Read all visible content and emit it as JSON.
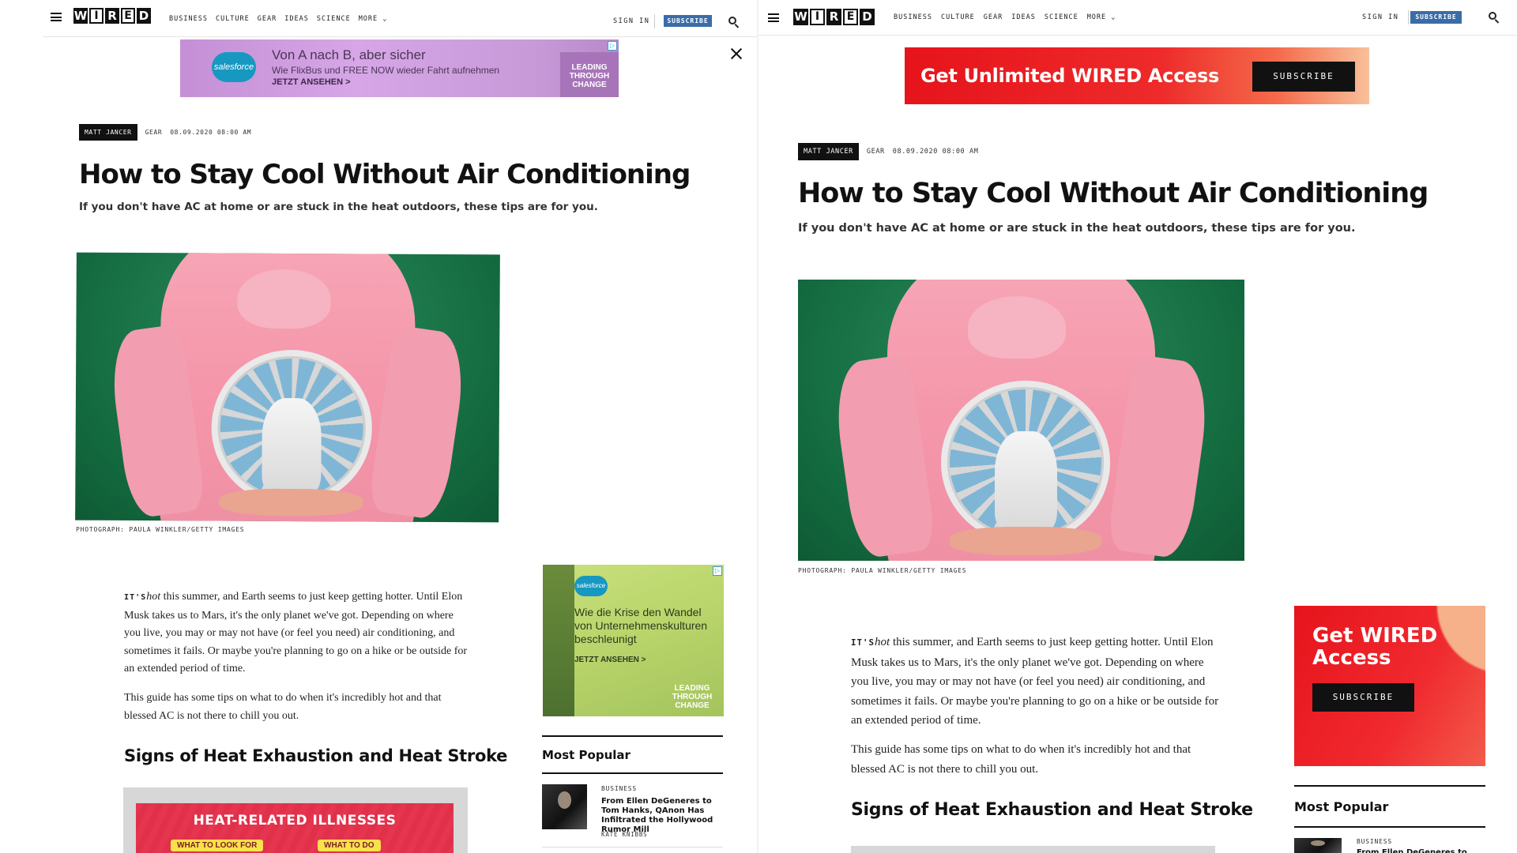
{
  "nav": {
    "logo_letters": [
      "W",
      "I",
      "R",
      "E",
      "D"
    ],
    "links": [
      "BUSINESS",
      "CULTURE",
      "GEAR",
      "IDEAS",
      "SCIENCE",
      "MORE"
    ],
    "sign_in": "SIGN IN",
    "subscribe": "SUBSCRIBE"
  },
  "ad_top": {
    "brand": "salesforce",
    "line1": "Von A nach B, aber sicher",
    "line2": "Wie FlixBus und FREE NOW wieder Fahrt aufnehmen",
    "cta": "JETZT ANSEHEN >",
    "tag": "LEADING THROUGH CHANGE"
  },
  "banner_top": {
    "text": "Get Unlimited WIRED Access",
    "button": "SUBSCRIBE"
  },
  "article": {
    "author": "MATT JANCER",
    "category": "GEAR",
    "date": "08.09.2020 08:00 AM",
    "title": "How to Stay Cool Without Air Conditioning",
    "dek": "If you don't have AC at home or are stuck in the heat outdoors, these tips are for you.",
    "photo_credit": "PHOTOGRAPH: PAULA WINKLER/GETTY IMAGES",
    "p1_lead": "IT'S",
    "p1_italic": "hot",
    "p1_rest": " this summer, and Earth seems to just keep getting hotter. Until Elon Musk takes us to Mars, it's the only planet we've got. Depending on where you live, you may or may not have (or feel you need) air conditioning, and sometimes it fails. Or maybe you're planning to go on a hike or be outside for an extended period of time.",
    "p2": "This guide has some tips on what to do when it's incredibly hot and that blessed AC is not there to chill you out.",
    "subhead": "Signs of Heat Exhaustion and Heat Stroke"
  },
  "heat_image": {
    "title": "HEAT-RELATED ILLNESSES",
    "left_label": "WHAT TO LOOK FOR",
    "right_label": "WHAT TO DO"
  },
  "side_ad": {
    "brand": "salesforce",
    "text": "Wie die Krise den Wandel von Unternehmenskulturen beschleunigt",
    "cta": "JETZT ANSEHEN >",
    "tag": "LEADING THROUGH CHANGE"
  },
  "most_popular": {
    "heading": "Most Popular",
    "item": {
      "category": "BUSINESS",
      "title": "From Ellen DeGeneres to Tom Hanks, QAnon Has Infiltrated the Hollywood Rumor Mill",
      "title_partial": "From Ellen DeGeneres to Tom",
      "author": "KATE KNIBBS"
    }
  },
  "promo": {
    "text": "Get WIRED Access",
    "button": "SUBSCRIBE"
  }
}
